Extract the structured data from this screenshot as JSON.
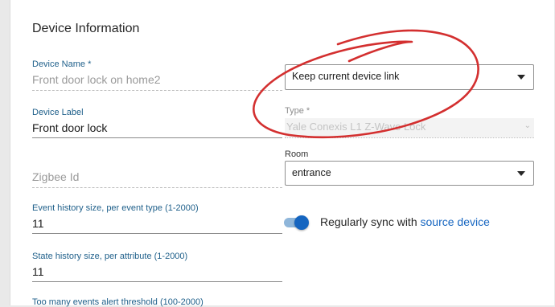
{
  "section_title": "Device Information",
  "device_name": {
    "label": "Device Name *",
    "value": "Front door lock on home2"
  },
  "device_label": {
    "label": "Device Label",
    "value": "Front door lock"
  },
  "zigbee": {
    "placeholder": "Zigbee Id"
  },
  "event_history": {
    "label": "Event history size, per event type (1-2000)",
    "value": "11"
  },
  "state_history": {
    "label": "State history size, per attribute (1-2000)",
    "value": "11"
  },
  "too_many_events": {
    "label": "Too many events alert threshold (100-2000)"
  },
  "device_link": {
    "value": "Keep current device link"
  },
  "type": {
    "label": "Type *",
    "value": "Yale Conexis L1 Z-Wave Lock"
  },
  "room": {
    "label": "Room",
    "value": "entrance"
  },
  "sync": {
    "enabled": true,
    "text": "Regularly sync with ",
    "link_text": "source device"
  },
  "colors": {
    "accent": "#1565c0",
    "label_blue": "#1e5f8a",
    "annotation_red": "#d32f2f"
  }
}
